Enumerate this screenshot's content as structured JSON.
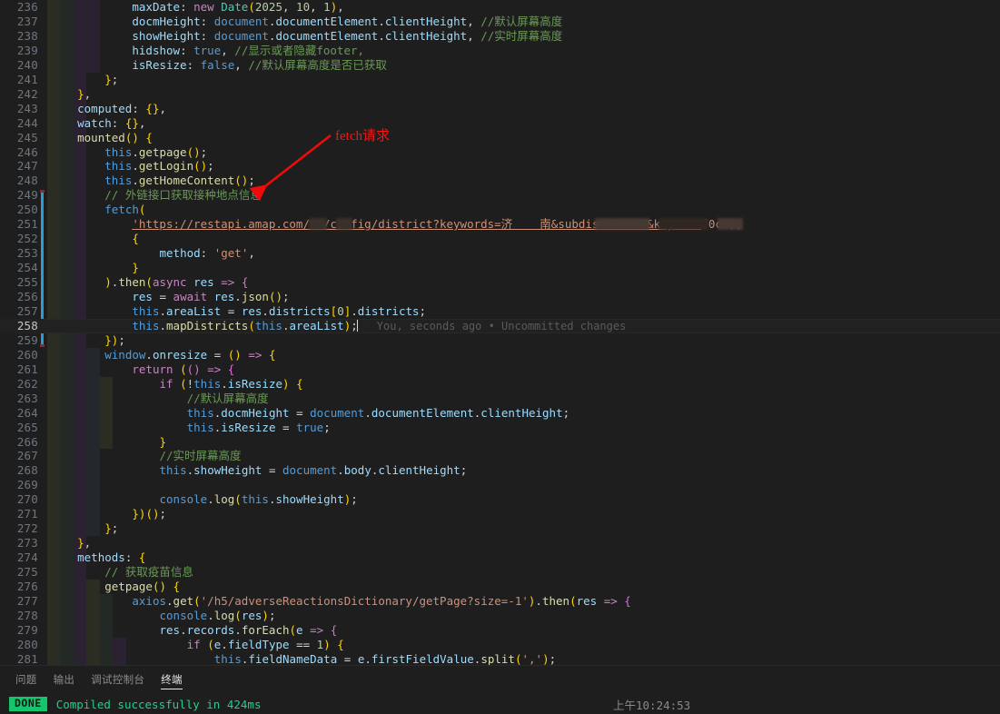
{
  "editor": {
    "first_line": 236,
    "active_line": 258,
    "blame_annotation": "You, seconds ago • Uncommitted changes",
    "url_line_text": "'https://restapi.amap.com/v3/config/district?keywords=济    南&subdistrict=3&key=283",
    "url_line_tail": "f0c',",
    "lines": [
      {
        "n": 236,
        "text": "            maxDate: new Date(2025, 10, 1),"
      },
      {
        "n": 237,
        "text": "            docmHeight: document.documentElement.clientHeight, //默认屏幕高度"
      },
      {
        "n": 238,
        "text": "            showHeight: document.documentElement.clientHeight, //实时屏幕高度"
      },
      {
        "n": 239,
        "text": "            hidshow: true, //显示或者隐藏footer,"
      },
      {
        "n": 240,
        "text": "            isResize: false, //默认屏幕高度是否已获取"
      },
      {
        "n": 241,
        "text": "        };"
      },
      {
        "n": 242,
        "text": "    },"
      },
      {
        "n": 243,
        "text": "    computed: {},"
      },
      {
        "n": 244,
        "text": "    watch: {},"
      },
      {
        "n": 245,
        "text": "    mounted() {"
      },
      {
        "n": 246,
        "text": "        this.getpage();"
      },
      {
        "n": 247,
        "text": "        this.getLogin();"
      },
      {
        "n": 248,
        "text": "        this.getHomeContent();"
      },
      {
        "n": 249,
        "text": "        // 外链接口获取接种地点信息"
      },
      {
        "n": 250,
        "text": "        fetch("
      },
      {
        "n": 251,
        "text": ""
      },
      {
        "n": 252,
        "text": "            {"
      },
      {
        "n": 253,
        "text": "                method: 'get',"
      },
      {
        "n": 254,
        "text": "            }"
      },
      {
        "n": 255,
        "text": "        ).then(async res => {"
      },
      {
        "n": 256,
        "text": "            res = await res.json();"
      },
      {
        "n": 257,
        "text": "            this.areaList = res.districts[0].districts;"
      },
      {
        "n": 258,
        "text": "            this.mapDistricts(this.areaList);"
      },
      {
        "n": 259,
        "text": "        });"
      },
      {
        "n": 260,
        "text": "        window.onresize = () => {"
      },
      {
        "n": 261,
        "text": "            return (() => {"
      },
      {
        "n": 262,
        "text": "                if (!this.isResize) {"
      },
      {
        "n": 263,
        "text": "                    //默认屏幕高度"
      },
      {
        "n": 264,
        "text": "                    this.docmHeight = document.documentElement.clientHeight;"
      },
      {
        "n": 265,
        "text": "                    this.isResize = true;"
      },
      {
        "n": 266,
        "text": "                }"
      },
      {
        "n": 267,
        "text": "                //实时屏幕高度"
      },
      {
        "n": 268,
        "text": "                this.showHeight = document.body.clientHeight;"
      },
      {
        "n": 269,
        "text": ""
      },
      {
        "n": 270,
        "text": "                console.log(this.showHeight);"
      },
      {
        "n": 271,
        "text": "            })();"
      },
      {
        "n": 272,
        "text": "        };"
      },
      {
        "n": 273,
        "text": "    },"
      },
      {
        "n": 274,
        "text": "    methods: {"
      },
      {
        "n": 275,
        "text": "        // 获取疫苗信息"
      },
      {
        "n": 276,
        "text": "        getpage() {"
      },
      {
        "n": 277,
        "text": "            axios.get('/h5/adverseReactionsDictionary/getPage?size=-1').then(res => {"
      },
      {
        "n": 278,
        "text": "                console.log(res);"
      },
      {
        "n": 279,
        "text": "                res.records.forEach(e => {"
      },
      {
        "n": 280,
        "text": "                    if (e.fieldType == 1) {"
      },
      {
        "n": 281,
        "text": "                        this.fieldNameData = e.firstFieldValue.split(',');"
      }
    ]
  },
  "annotation": {
    "label": "fetch请求",
    "color": "#ff1111",
    "arrow_icon": "red-arrow-icon"
  },
  "panel": {
    "tabs": [
      {
        "label": "问题",
        "active": false
      },
      {
        "label": "输出",
        "active": false
      },
      {
        "label": "调试控制台",
        "active": false
      },
      {
        "label": "终端",
        "active": true
      }
    ],
    "terminal": {
      "badge": "DONE",
      "message": "Compiled successfully in 424ms",
      "timestamp": "上午10:24:53",
      "badge_color": "#15c46b",
      "message_color": "#1fd18a"
    }
  }
}
